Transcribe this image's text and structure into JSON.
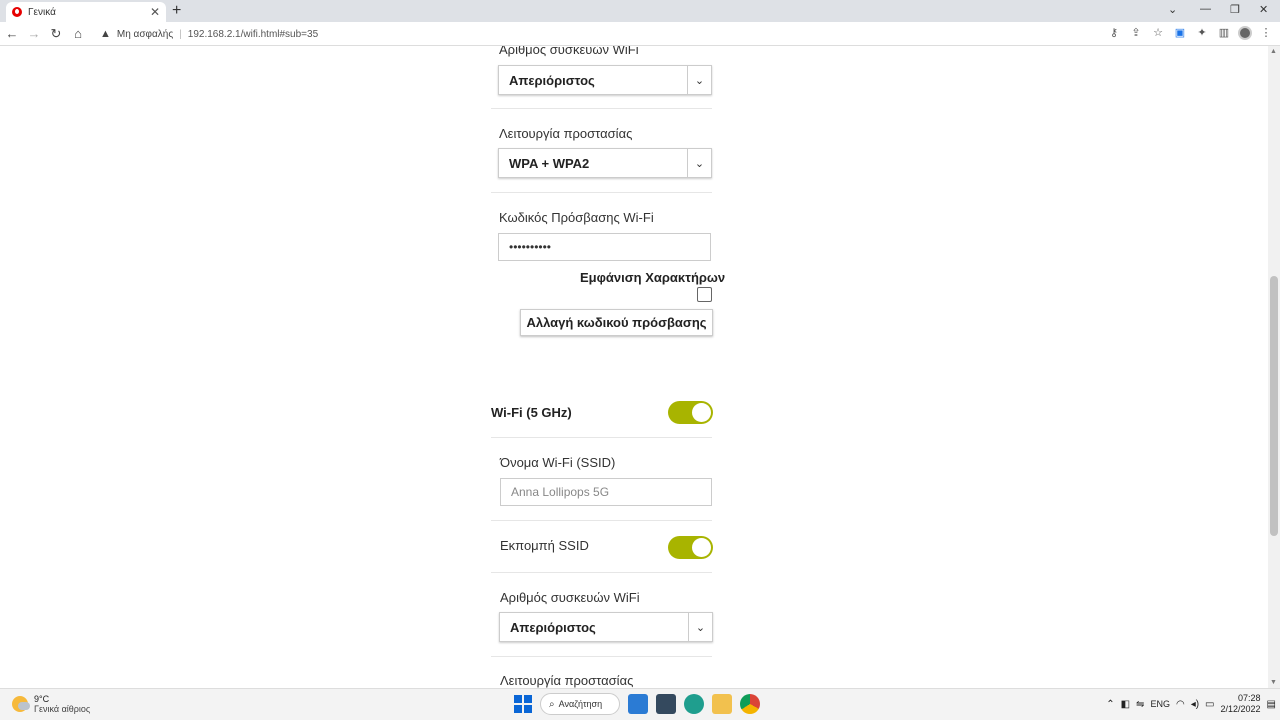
{
  "browser": {
    "tab_title": "Γενικά",
    "security_label": "Μη ασφαλής",
    "url": "192.168.2.1/wifi.html#sub=35"
  },
  "section24": {
    "devices_label": "Αριθμός συσκευών WiFi",
    "devices_value": "Απεριόριστος",
    "protection_label": "Λειτουργία προστασίας",
    "protection_value": "WPA + WPA2",
    "password_label": "Κωδικός Πρόσβασης Wi-Fi",
    "password_value": "••••••••••",
    "show_chars_label": "Εμφάνιση Χαρακτήρων",
    "change_password_label": "Αλλαγή κωδικού πρόσβασης"
  },
  "section5": {
    "title": "Wi-Fi (5 GHz)",
    "ssid_label": "Όνομα Wi-Fi (SSID)",
    "ssid_placeholder": "Anna Lollipops 5G",
    "broadcast_label": "Εκπομπή SSID",
    "devices_label": "Αριθμός συσκευών WiFi",
    "devices_value": "Απεριόριστος",
    "protection_label": "Λειτουργία προστασίας"
  },
  "taskbar": {
    "temperature": "9°C",
    "weather_desc": "Γενικά αίθριος",
    "search_label": "Αναζήτηση",
    "language": "ENG",
    "time": "07:28",
    "date": "2/12/2022"
  },
  "colors": {
    "toggle_on": "#a8b400",
    "brand": "#e60000"
  }
}
